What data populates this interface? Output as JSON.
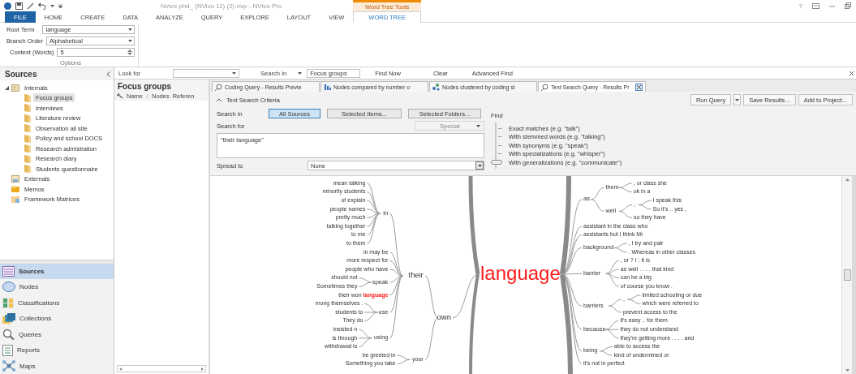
{
  "title_bar": {
    "title": "Nvivo phd_ (NVivo 11) (2).nvp - NVivo Pro",
    "context_tab": "Word Tree Tools",
    "help": "?"
  },
  "ribbon_tabs": [
    {
      "label": "FILE",
      "kind": "file",
      "selected": false
    },
    {
      "label": "HOME",
      "kind": "tab",
      "selected": false
    },
    {
      "label": "CREATE",
      "kind": "tab",
      "selected": false
    },
    {
      "label": "DATA",
      "kind": "tab",
      "selected": false
    },
    {
      "label": "ANALYZE",
      "kind": "tab",
      "selected": false
    },
    {
      "label": "QUERY",
      "kind": "tab",
      "selected": false
    },
    {
      "label": "EXPLORE",
      "kind": "tab",
      "selected": false
    },
    {
      "label": "LAYOUT",
      "kind": "tab",
      "selected": false
    },
    {
      "label": "VIEW",
      "kind": "tab",
      "selected": false
    },
    {
      "label": "WORD  TREE",
      "kind": "context",
      "selected": true
    }
  ],
  "options": {
    "root_term_label": "Root Term",
    "root_term": "language",
    "branch_order_label": "Branch Order",
    "branch_order": "Alphabetical",
    "context_label": "Context (Words)",
    "context": "5",
    "group_label": "Options"
  },
  "find_bar": {
    "look_for_label": "Look for",
    "search_in_label": "Search In",
    "search_in": "Focus groups",
    "buttons": [
      "Find Now",
      "Clear",
      "Advanced Find"
    ]
  },
  "navigator": {
    "title": "Sources",
    "tree": [
      {
        "label": "Internals",
        "kind": "internals",
        "expanded": true,
        "selected": false,
        "children": [
          {
            "label": "Focus groups",
            "kind": "folder",
            "selected": true
          },
          {
            "label": "Interviews",
            "kind": "folder",
            "selected": false
          },
          {
            "label": "Literature review",
            "kind": "folder",
            "selected": false
          },
          {
            "label": "Observation all site",
            "kind": "folder",
            "selected": false
          },
          {
            "label": "Policy and school DOCS",
            "kind": "folder",
            "selected": false
          },
          {
            "label": "Research admistration",
            "kind": "folder",
            "selected": false
          },
          {
            "label": "Research diary",
            "kind": "folder",
            "selected": false
          },
          {
            "label": "Students questionnaire",
            "kind": "folder",
            "selected": false
          }
        ]
      },
      {
        "label": "Externals",
        "kind": "externals",
        "selected": false
      },
      {
        "label": "Memos",
        "kind": "memos",
        "selected": false
      },
      {
        "label": "Framework Matrices",
        "kind": "matrices",
        "selected": false
      }
    ],
    "buttons": [
      {
        "label": "Sources",
        "kind": "sources",
        "selected": true
      },
      {
        "label": "Nodes",
        "kind": "nodes",
        "selected": false
      },
      {
        "label": "Classifications",
        "kind": "classifications",
        "selected": false
      },
      {
        "label": "Collections",
        "kind": "collections",
        "selected": false
      },
      {
        "label": "Queries",
        "kind": "queries",
        "selected": false
      },
      {
        "label": "Reports",
        "kind": "reports",
        "selected": false
      },
      {
        "label": "Maps",
        "kind": "maps",
        "selected": false
      }
    ]
  },
  "list_view": {
    "title": "Focus groups",
    "columns": [
      "Name",
      "Nodes",
      "Referen"
    ]
  },
  "document_tabs": [
    {
      "label": "Coding Query - Results Previe",
      "kind": "coding",
      "selected": false
    },
    {
      "label": "Nodes compared by number o",
      "kind": "chart",
      "selected": false
    },
    {
      "label": "Nodes clustered by coding si",
      "kind": "cluster",
      "selected": false
    },
    {
      "label": "Text Search Query - Results Pr",
      "kind": "search",
      "selected": true
    }
  ],
  "criteria": {
    "title": "Text Search Criteria",
    "actions": [
      "Run Query",
      "Save Results...",
      "Add to Project..."
    ],
    "search_in_label": "Search in",
    "scope_buttons": [
      {
        "label": "All Sources",
        "selected": true
      },
      {
        "label": "Selected Items...",
        "selected": false
      },
      {
        "label": "Selected Folders...",
        "selected": false
      }
    ],
    "search_for_label": "Search for",
    "special": "Special",
    "query": "\"their language\"",
    "spread_label": "Spread to",
    "spread": "None",
    "find_label": "Find",
    "find_options": [
      {
        "label": "Exact matches (e.g. \"talk\")",
        "selected": false
      },
      {
        "label": "With stemmed words (e.g. \"talking\")",
        "selected": false
      },
      {
        "label": "With synonyms (e.g. \"speak\")",
        "selected": false
      },
      {
        "label": "With specializations (e.g. \"whisper\")",
        "selected": false
      },
      {
        "label": "With generalizations (e.g. \"communicate\")",
        "selected": true
      }
    ]
  },
  "word_tree": {
    "root": "language",
    "left": [
      {
        "text": "own",
        "children": [
          {
            "text": "their",
            "children": [
              {
                "text": "in",
                "children": [
                  {
                    "text": "mean talking"
                  },
                  {
                    "text": "minority students"
                  },
                  {
                    "text": "of explain"
                  },
                  {
                    "text": "people names"
                  },
                  {
                    "text": "pretty much"
                  },
                  {
                    "text": "talking together"
                  },
                  {
                    "text": "to me"
                  },
                  {
                    "text": "to them"
                  }
                ]
              },
              {
                "text": "in may be"
              },
              {
                "text": "more respect for"
              },
              {
                "text": "people who have"
              },
              {
                "text": "speak",
                "children": [
                  {
                    "text": "should not"
                  },
                  {
                    "text": "Sometimes they"
                  }
                ]
              },
              {
                "text": "their won **language**"
              },
              {
                "text": "use",
                "children": [
                  {
                    "text": "mong themselves ."
                  },
                  {
                    "text": "students to"
                  },
                  {
                    "text": "They do"
                  }
                ]
              },
              {
                "text": "using",
                "children": [
                  {
                    "text": "insisted n"
                  },
                  {
                    "text": "is through"
                  },
                  {
                    "text": "withdrawal is"
                  }
                ]
              }
            ]
          },
          {
            "text": "your",
            "children": [
              {
                "text": "be greeted in"
              },
              {
                "text": "Something you take"
              }
            ]
          }
        ]
      }
    ],
    "right": [
      {
        "text": "as",
        "children": [
          {
            "text": "them",
            "children": [
              {
                "text": ", or class she"
              },
              {
                "text": "ok in a"
              }
            ]
          },
          {
            "text": "well",
            "children": [
              {
                "text": ",",
                "children": [
                  {
                    "text": "I speak this"
                  },
                  {
                    "text": "So it's .. yes ,"
                  }
                ]
              },
              {
                "text": "so they have"
              }
            ]
          }
        ]
      },
      {
        "text": "assistant in the class who"
      },
      {
        "text": "assistants but I think Mr"
      },
      {
        "text": "background",
        "children": [
          {
            "text": ", I try and pair"
          },
          {
            "text": ". Whereas in other classes"
          }
        ]
      },
      {
        "text": "barrier",
        "children": [
          {
            "text": ", or ? I : it is"
          },
          {
            "text": "as well . . . . that kind"
          },
          {
            "text": "can be a big"
          },
          {
            "text": "of course you know ."
          }
        ]
      },
      {
        "text": "barriers",
        "children": [
          {
            "text": ",",
            "children": [
              {
                "text": "limited schooling or due"
              },
              {
                "text": "which were referred to"
              }
            ]
          },
          {
            "text": "prevent access to the"
          }
        ]
      },
      {
        "text": "because",
        "children": [
          {
            "text": "it's easy .. for them"
          },
          {
            "text": "they do not understand"
          },
          {
            "text": "they're getting more . . . . and"
          }
        ]
      },
      {
        "text": "being",
        "children": [
          {
            "text": "able to access the"
          },
          {
            "text": "kind of undermined or"
          }
        ]
      },
      {
        "text": "it's not in perfect"
      }
    ]
  }
}
